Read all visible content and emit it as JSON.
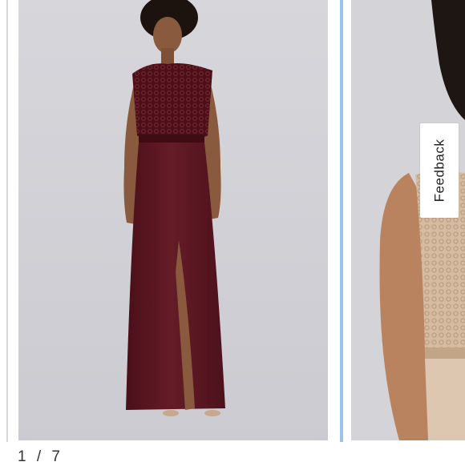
{
  "carousel": {
    "current": "1",
    "separator": "/",
    "total": "7",
    "slides": [
      {
        "subject": "model-burgundy-lace-gown",
        "dress_color": "#5a1520"
      },
      {
        "subject": "model-champagne-lace-gown",
        "dress_color": "#d9c0a6"
      }
    ],
    "active_indicator_color": "#9cc3ec"
  },
  "feedback": {
    "label": "Feedback"
  }
}
